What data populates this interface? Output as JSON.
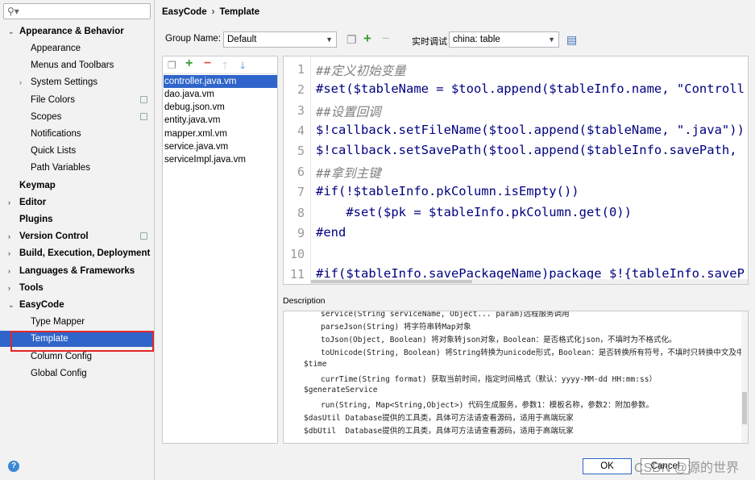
{
  "sidebar": {
    "search_placeholder": "",
    "items": [
      {
        "label": "Appearance & Behavior",
        "arrow": "⌄"
      },
      {
        "label": "Appearance"
      },
      {
        "label": "Menus and Toolbars"
      },
      {
        "label": "System Settings",
        "arrow": "›"
      },
      {
        "label": "File Colors"
      },
      {
        "label": "Scopes"
      },
      {
        "label": "Notifications"
      },
      {
        "label": "Quick Lists"
      },
      {
        "label": "Path Variables"
      },
      {
        "label": "Keymap"
      },
      {
        "label": "Editor",
        "arrow": "›"
      },
      {
        "label": "Plugins"
      },
      {
        "label": "Version Control",
        "arrow": "›"
      },
      {
        "label": "Build, Execution, Deployment",
        "arrow": "›"
      },
      {
        "label": "Languages & Frameworks",
        "arrow": "›"
      },
      {
        "label": "Tools",
        "arrow": "›"
      },
      {
        "label": "EasyCode",
        "arrow": "⌄"
      },
      {
        "label": "Type Mapper"
      },
      {
        "label": "Template"
      },
      {
        "label": "Column Config"
      },
      {
        "label": "Global Config"
      }
    ],
    "help": "?"
  },
  "breadcrumb": {
    "root": "EasyCode",
    "sep": "›",
    "current": "Template"
  },
  "toolbar": {
    "group_label": "Group Name:",
    "group_value": "Default",
    "debug_label": "实时调试",
    "debug_value": "china: table"
  },
  "files": [
    "controller.java.vm",
    "dao.java.vm",
    "debug.json.vm",
    "entity.java.vm",
    "mapper.xml.vm",
    "service.java.vm",
    "serviceImpl.java.vm"
  ],
  "editor": {
    "line_numbers": [
      "1",
      "2",
      "3",
      "4",
      "5",
      "6",
      "7",
      "8",
      "9",
      "10",
      "11"
    ],
    "lines": [
      "##定义初始变量",
      "#set($tableName = $tool.append($tableInfo.name, \"Controll",
      "##设置回调",
      "$!callback.setFileName($tool.append($tableName, \".java\"))",
      "$!callback.setSavePath($tool.append($tableInfo.savePath,",
      "##拿到主键",
      "#if(!$tableInfo.pkColumn.isEmpty())",
      "    #set($pk = $tableInfo.pkColumn.get(0))",
      "#end",
      "",
      "#if($tableInfo.savePackageName)package $!{tableInfo.saveP"
    ]
  },
  "description": {
    "label": "Description",
    "lines": [
      "service(String serviceName, Object... param)远程服务调用",
      "parseJson(String) 将字符串转Map对象",
      "toJson(Object, Boolean) 将对象转json对象，Boolean：是否格式化json，不填时为不格式化。",
      "toUnicode(String, Boolean) 将String转换为unicode形式，Boolean：是否转换所有符号，不填时只转换中文及中",
      "$time",
      "currTime(String format) 获取当前时间，指定时间格式（默认：yyyy-MM-dd HH:mm:ss）",
      "$generateService",
      "run(String, Map<String,Object>) 代码生成服务，参数1：模板名称，参数2：附加参数。",
      "$dasUtil Database提供的工具类，具体可方法请查看源码，适用于高端玩家",
      "$dbUtil  Database提供的工具类，具体可方法请查看源码，适用于高端玩家"
    ]
  },
  "buttons": {
    "ok": "OK",
    "cancel": "Cancel"
  },
  "watermark": "CSDN @源的世界",
  "colors": {
    "selection": "#2f65ca",
    "highlight_box": "#e2262a",
    "add": "#3a9c3a",
    "remove": "#d9534f",
    "move": "#3c86d6"
  }
}
